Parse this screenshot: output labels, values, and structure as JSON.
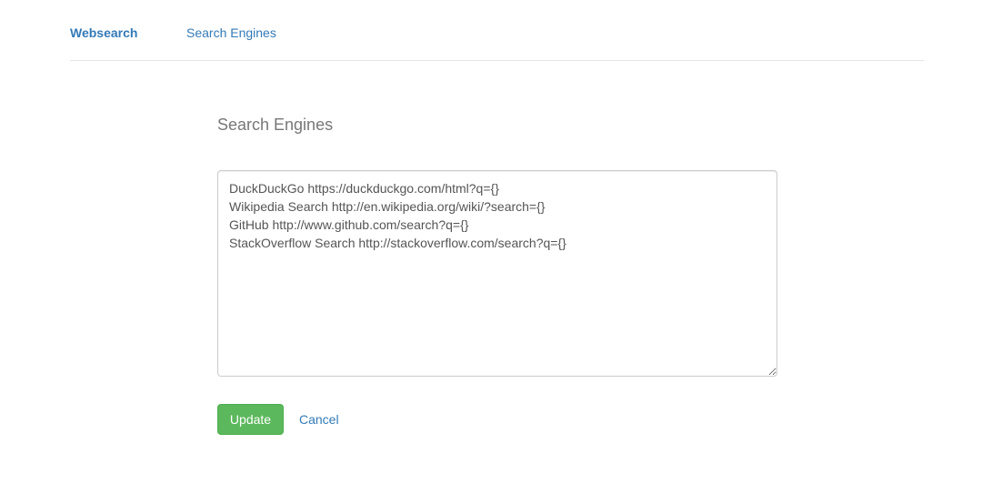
{
  "navbar": {
    "brand": "Websearch",
    "links": [
      {
        "label": "Search Engines"
      }
    ]
  },
  "main": {
    "title": "Search Engines",
    "engines_text": "DuckDuckGo https://duckduckgo.com/html?q={}\nWikipedia Search http://en.wikipedia.org/wiki/?search={}\nGitHub http://www.github.com/search?q={}\nStackOverflow Search http://stackoverflow.com/search?q={}",
    "update_label": "Update",
    "cancel_label": "Cancel"
  },
  "colors": {
    "link": "#337ab7",
    "success": "#5cb85c",
    "title": "#777777"
  }
}
